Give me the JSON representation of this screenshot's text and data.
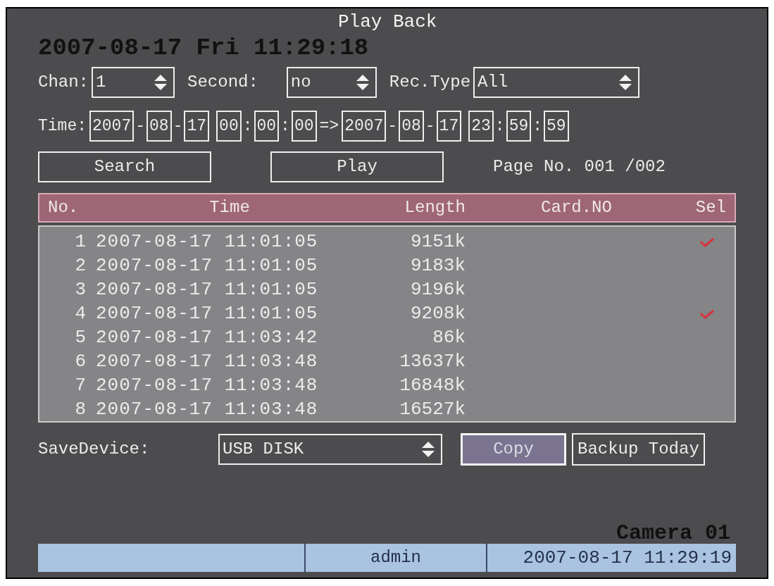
{
  "osd_clock": "2007-08-17 Fri 11:29:18",
  "title": "Play Back",
  "filters": [
    {
      "label": "Chan:",
      "value": "1",
      "kind": "short"
    },
    {
      "label": "Second:",
      "value": "no",
      "kind": "medium"
    },
    {
      "label": "Rec.Type",
      "value": "All",
      "kind": "wide"
    }
  ],
  "time_range": {
    "label": "Time:",
    "arrow": "=>",
    "start": [
      {
        "value": "2007",
        "sep": "-"
      },
      {
        "value": "08",
        "sep": "-"
      },
      {
        "value": "17"
      },
      {
        "value": "00",
        "sep": ":"
      },
      {
        "value": "00",
        "sep": ":"
      },
      {
        "value": "00"
      }
    ],
    "end": [
      {
        "value": "2007",
        "sep": "-"
      },
      {
        "value": "08",
        "sep": "-"
      },
      {
        "value": "17"
      },
      {
        "value": "23",
        "sep": ":"
      },
      {
        "value": "59",
        "sep": ":"
      },
      {
        "value": "59"
      }
    ]
  },
  "actions": [
    {
      "label": "Search"
    },
    {
      "label": "Play"
    }
  ],
  "page_no": "Page No. 001 /002",
  "table": {
    "columns": [
      "No.",
      "Time",
      "Length",
      "Card.NO",
      "Sel"
    ],
    "rows": [
      {
        "no": "1",
        "time": "2007-08-17 11:01:05",
        "length": "9151k",
        "selected": true
      },
      {
        "no": "2",
        "time": "2007-08-17 11:01:05",
        "length": "9183k",
        "selected": false
      },
      {
        "no": "3",
        "time": "2007-08-17 11:01:05",
        "length": "9196k",
        "selected": false
      },
      {
        "no": "4",
        "time": "2007-08-17 11:01:05",
        "length": "9208k",
        "selected": true
      },
      {
        "no": "5",
        "time": "2007-08-17 11:03:42",
        "length": "86k",
        "selected": false
      },
      {
        "no": "6",
        "time": "2007-08-17 11:03:48",
        "length": "13637k",
        "selected": false
      },
      {
        "no": "7",
        "time": "2007-08-17 11:03:48",
        "length": "16848k",
        "selected": false
      },
      {
        "no": "8",
        "time": "2007-08-17 11:03:48",
        "length": "16527k",
        "selected": false
      }
    ]
  },
  "save_device": {
    "label": "SaveDevice:",
    "value": "USB DISK"
  },
  "backup_buttons": [
    {
      "label": "Copy",
      "focused": true
    },
    {
      "label": "Backup Today",
      "focused": false
    }
  ],
  "camera_name": "Camera 01",
  "status_bar": {
    "user": "admin",
    "datetime": "2007-08-17 11:29:19"
  }
}
